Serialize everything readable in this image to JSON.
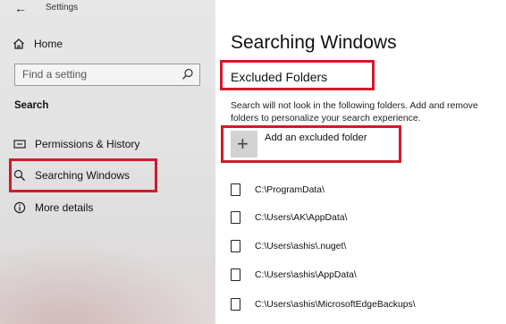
{
  "window": {
    "title": "Settings",
    "back_icon": "back-arrow-icon"
  },
  "sidebar": {
    "home_label": "Home",
    "home_icon": "home-icon",
    "search_placeholder": "Find a setting",
    "search_icon": "search-icon",
    "section_title": "Search",
    "items": [
      {
        "label": "Permissions & History",
        "icon": "permissions-history-icon"
      },
      {
        "label": "Searching Windows",
        "icon": "search-icon",
        "selected": true,
        "highlighted": true
      },
      {
        "label": "More details",
        "icon": "info-icon"
      }
    ]
  },
  "main": {
    "title": "Searching Windows",
    "section_heading": "Excluded Folders",
    "description": "Search will not look in the following folders. Add and remove folders to personalize your search experience.",
    "add_button_label": "Add an excluded folder",
    "add_button_icon": "plus-icon",
    "folders": [
      "C:\\ProgramData\\",
      "C:\\Users\\AK\\AppData\\",
      "C:\\Users\\ashis\\.nuget\\",
      "C:\\Users\\ashis\\AppData\\",
      "C:\\Users\\ashis\\MicrosoftEdgeBackups\\"
    ],
    "folder_icon": "document-icon"
  },
  "annotations": {
    "highlight_color": "#d21a2b"
  }
}
